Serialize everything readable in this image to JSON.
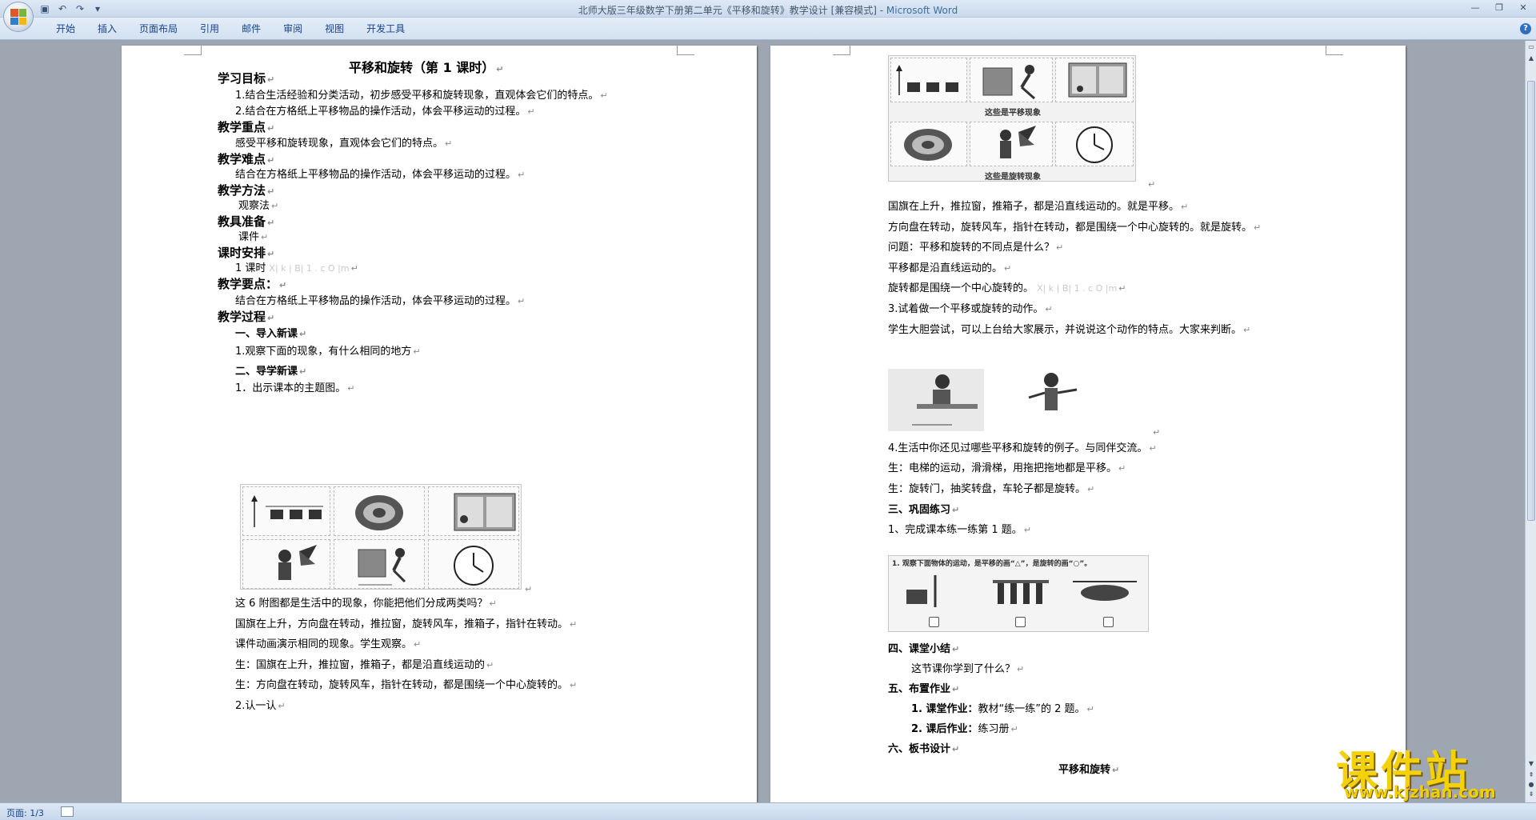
{
  "window": {
    "title": "北师大版三年级数学下册第二单元《平移和旋转》教学设计 [兼容模式] - ",
    "app_name": "Microsoft Word"
  },
  "ribbon": {
    "tabs": [
      "开始",
      "插入",
      "页面布局",
      "引用",
      "邮件",
      "审阅",
      "视图",
      "开发工具"
    ]
  },
  "page1": {
    "title": "平移和旋转（第 1 课时）",
    "lines": [
      {
        "text": "学习目标",
        "style": "h"
      },
      {
        "text": "1.结合生活经验和分类活动，初步感受平移和旋转现象，直观体会它们的特点。",
        "style": "p"
      },
      {
        "text": "2.结合在方格纸上平移物品的操作活动，体会平移运动的过程。",
        "style": "p"
      },
      {
        "text": "教学重点",
        "style": "h"
      },
      {
        "text": "感受平移和旋转现象，直观体会它们的特点。",
        "style": "p"
      },
      {
        "text": "教学难点",
        "style": "h"
      },
      {
        "text": "结合在方格纸上平移物品的操作活动，体会平移运动的过程。",
        "style": "p"
      },
      {
        "text": "教学方法",
        "style": "h"
      },
      {
        "text": "观察法",
        "style": "p"
      },
      {
        "text": "教具准备",
        "style": "h"
      },
      {
        "text": "课件",
        "style": "p"
      },
      {
        "text": "课时安排",
        "style": "h"
      },
      {
        "text": "1 课时",
        "style": "p",
        "watermark": "X| k | B| 1 . c O |m"
      },
      {
        "text": "教学要点：",
        "style": "h"
      },
      {
        "text": "结合在方格纸上平移物品的操作活动，体会平移运动的过程。",
        "style": "p"
      },
      {
        "text": "教学过程",
        "style": "h"
      },
      {
        "text": "一、导入新课",
        "style": "sub"
      },
      {
        "text": "1.观察下面的现象，有什么相同的地方",
        "style": "p"
      },
      {
        "text": "二、导学新课",
        "style": "sub"
      },
      {
        "text": "1．出示课本的主题图。",
        "style": "p"
      }
    ],
    "after_figure": [
      "这 6 附图都是生活中的现象，你能把他们分成两类吗？",
      "国旗在上升，方向盘在转动，推拉窗，旋转风车，推箱子，指针在转动。",
      "课件动画演示相同的现象。学生观察。",
      "生：国旗在上升，推拉窗，推箱子，都是沿直线运动的",
      "生：方向盘在转动，旋转风车，指针在转动，都是围绕一个中心旋转的。",
      "2.认一认"
    ]
  },
  "page2": {
    "figure_captions": [
      "这些是平移现象",
      "这些是旋转现象"
    ],
    "lines_a": [
      {
        "text": "国旗在上升，推拉窗，推箱子，都是沿直线运动的。就是平移。"
      },
      {
        "text": "方向盘在转动，旋转风车，指针在转动，都是围绕一个中心旋转的。就是旋转。"
      },
      {
        "text": "问题：平移和旋转的不同点是什么？"
      },
      {
        "text": "平移都是沿直线运动的。"
      },
      {
        "text": "旋转都是围绕一个中心旋转的。",
        "watermark": "X| k | B| 1 . c O |m"
      },
      {
        "text": "3.试着做一个平移或旋转的动作。"
      },
      {
        "text": "学生大胆尝试，可以上台给大家展示，并说说这个动作的特点。大家来判断。"
      }
    ],
    "lines_b": [
      "4.生活中你还见过哪些平移和旋转的例子。与同伴交流。",
      "生：电梯的运动，滑滑梯，用拖把拖地都是平移。",
      "生：旋转门，抽奖转盘，车轮子都是旋转。",
      "三、巩固练习",
      "1、完成课本练一练第 1 题。"
    ],
    "exercise_caption": "1. 观察下面物体的运动，是平移的画“△”，是旋转的画“○”。",
    "lines_c": [
      {
        "text": "四、课堂小结",
        "style": "sub"
      },
      {
        "text": "这节课你学到了什么？",
        "style": "p"
      },
      {
        "text": "五、布置作业",
        "style": "sub"
      },
      {
        "text": "1. 课堂作业：教材“练一练”的 2 题。",
        "style": "p",
        "bold_prefix": "1. 课堂作业："
      },
      {
        "text": "2. 课后作业：练习册",
        "style": "p",
        "bold_prefix": "2. 课后作业："
      },
      {
        "text": "六、板书设计",
        "style": "sub"
      },
      {
        "text": "平移和旋转",
        "style": "center"
      }
    ]
  },
  "status": {
    "page": "页面: 1/3"
  },
  "logo": {
    "main": "课件站",
    "url": "www.kjzhan.com"
  },
  "colors": {
    "title_bar": "#dfe9f5",
    "ribbon_tab_text": "#15428b",
    "workspace": "#9ea6b1",
    "logo_yellow": "#f4d20a"
  }
}
